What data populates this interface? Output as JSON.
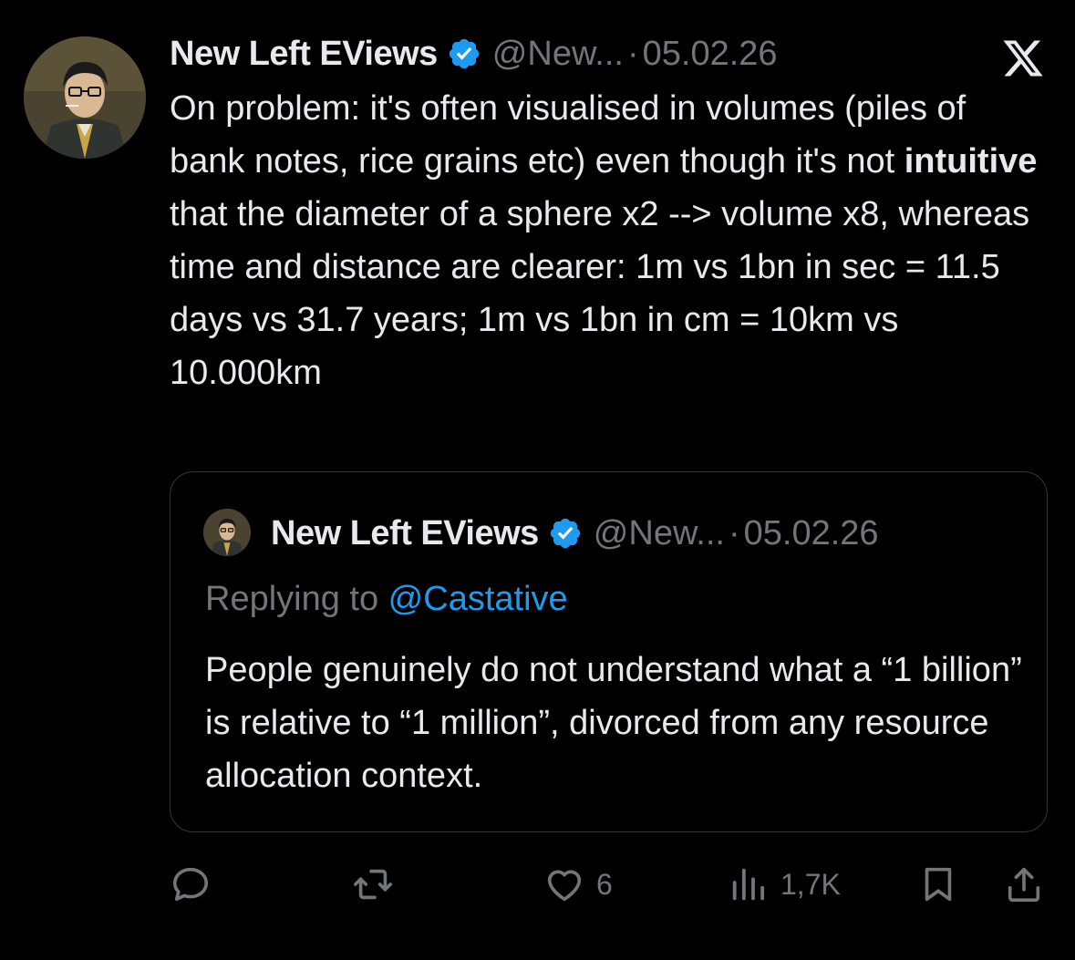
{
  "tweet": {
    "author_name": "New Left EViews",
    "handle": "@New...",
    "separator": "·",
    "date": "05.02.26",
    "text_pre": "On problem: it's often visualised in volumes (piles of bank notes, rice grains etc) even though it's not ",
    "text_bold": "intuitive",
    "text_post": " that the diameter of a sphere x2 --> volume x8, whereas time and distance are clearer: 1m vs 1bn in sec = 11.5 days vs 31.7 years; 1m vs 1bn in cm = 10km vs 10.000km"
  },
  "quoted_tweet": {
    "author_name": "New Left EViews",
    "handle": "@New...",
    "separator": "·",
    "date": "05.02.26",
    "replying_label": "Replying to ",
    "replying_to": "@Castative",
    "text": "People genuinely do not understand what a “1 billion” is relative to “1 million”, divorced from any resource allocation context."
  },
  "actions": {
    "reply_icon": "reply-icon",
    "retweet_icon": "retweet-icon",
    "like_icon": "heart-icon",
    "like_count": "6",
    "views_icon": "views-icon",
    "views_count": "1,7K",
    "bookmark_icon": "bookmark-icon",
    "share_icon": "share-icon"
  },
  "colors": {
    "background": "#000000",
    "text": "#e7e9ea",
    "muted": "#71767b",
    "accent": "#1d9bf0",
    "border": "#333639"
  }
}
